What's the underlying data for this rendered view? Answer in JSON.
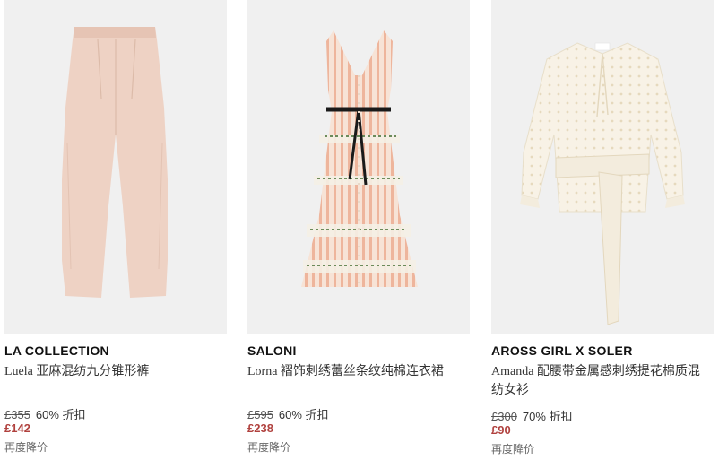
{
  "colors": {
    "sale_price": "#b0413e",
    "image_bg": "#f0f0f0"
  },
  "products": [
    {
      "brand": "LA COLLECTION",
      "name": "Luela 亚麻混纺九分锥形裤",
      "original_price": "£355",
      "discount": "60% 折扣",
      "sale_price": "£142",
      "note": "再度降价",
      "image": "beige-tapered-trousers"
    },
    {
      "brand": "SALONI",
      "name": "Lorna 褶饰刺绣蕾丝条纹纯棉连衣裙",
      "original_price": "£595",
      "discount": "60% 折扣",
      "sale_price": "£238",
      "note": "再度降价",
      "image": "striped-lace-sleeveless-dress"
    },
    {
      "brand": "AROSS GIRL X SOLER",
      "name": "Amanda 配腰带金属感刺绣提花棉质混纺女衫",
      "original_price": "£300",
      "discount": "70% 折扣",
      "sale_price": "£90",
      "note": "再度降价",
      "image": "cream-belted-jacquard-blouse"
    }
  ]
}
